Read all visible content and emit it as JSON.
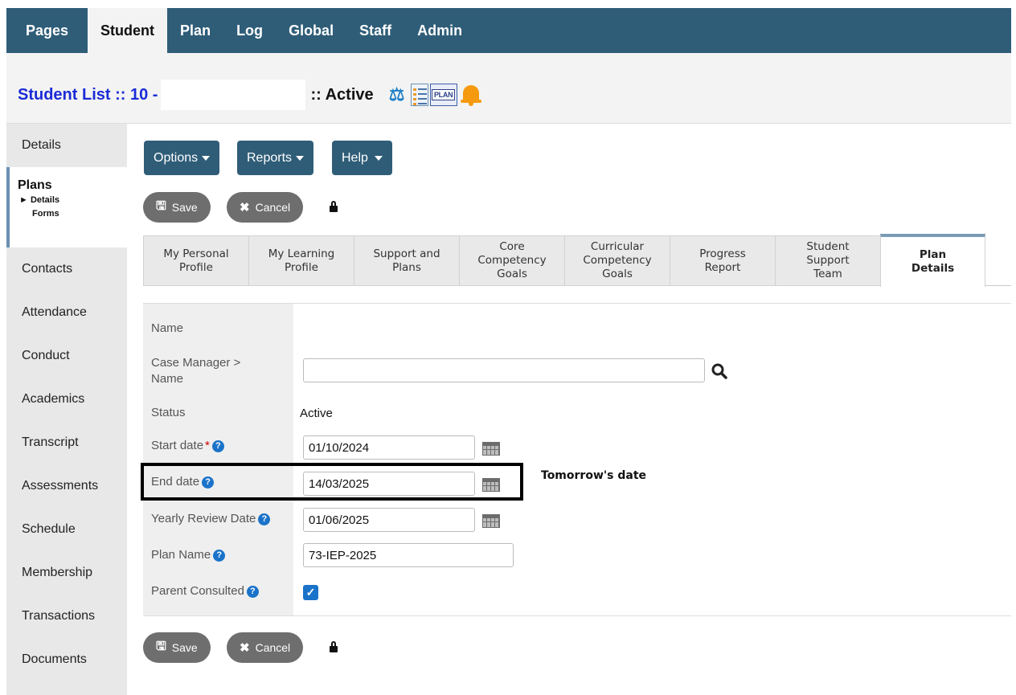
{
  "topnav": {
    "tabs": [
      "Pages",
      "Student",
      "Plan",
      "Log",
      "Global",
      "Staff",
      "Admin"
    ],
    "active": "Student"
  },
  "title": {
    "prefix": "Student List :: 10 -",
    "separator": ":: Active",
    "icons": [
      "scale-icon",
      "document-list-icon",
      "plan-icon",
      "bell-icon"
    ],
    "plan_icon_text": "PLAN"
  },
  "sidebar": {
    "items_top": [
      "Details"
    ],
    "plans": {
      "label": "Plans",
      "sub_details": "► Details",
      "sub_forms": "Forms"
    },
    "items": [
      "Contacts",
      "Attendance",
      "Conduct",
      "Academics",
      "Transcript",
      "Assessments",
      "Schedule",
      "Membership",
      "Transactions",
      "Documents"
    ]
  },
  "toolbar": {
    "options": "Options",
    "reports": "Reports",
    "help": "Help",
    "save": "Save",
    "cancel": "Cancel"
  },
  "tabs": [
    {
      "line1": "My Personal",
      "line2": "Profile",
      "line3": ""
    },
    {
      "line1": "My Learning",
      "line2": "Profile",
      "line3": ""
    },
    {
      "line1": "Support and",
      "line2": "Plans",
      "line3": ""
    },
    {
      "line1": "Core",
      "line2": "Competency",
      "line3": "Goals"
    },
    {
      "line1": "Curricular",
      "line2": "Competency",
      "line3": "Goals"
    },
    {
      "line1": "Progress",
      "line2": "Report",
      "line3": ""
    },
    {
      "line1": "Student",
      "line2": "Support",
      "line3": "Team"
    },
    {
      "line1": "Plan",
      "line2": "Details",
      "line3": ""
    }
  ],
  "form": {
    "name_label": "Name",
    "case_manager_label1": "Case Manager >",
    "case_manager_label2": "Name",
    "case_manager_value": "",
    "status_label": "Status",
    "status_value": "Active",
    "start_label": "Start date",
    "start_value": "01/10/2024",
    "end_label": "End date",
    "end_value": "14/03/2025",
    "review_label": "Yearly Review Date",
    "review_value": "01/06/2025",
    "plan_name_label": "Plan Name",
    "plan_name_value": "73-IEP-2025",
    "parent_label": "Parent Consulted",
    "parent_checked": true
  },
  "annotation": {
    "note": "Tomorrow's date"
  },
  "colors": {
    "nav": "#2f5d78",
    "link_blue": "#1a2bd6",
    "help_blue": "#1a73c9",
    "pill": "#6e6e6e"
  }
}
